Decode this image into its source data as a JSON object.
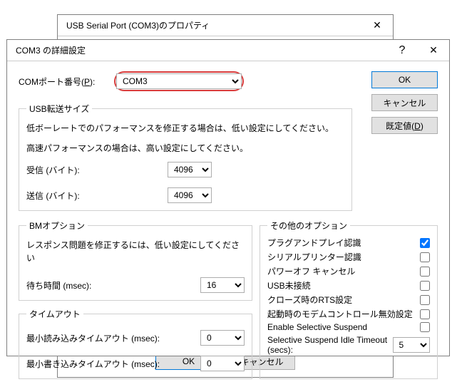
{
  "parent_window": {
    "title": "USB Serial Port (COM3)のプロパティ",
    "buttons": {
      "ok": "OK",
      "cancel": "キャンセル"
    }
  },
  "dialog": {
    "title": "COM3 の詳細設定",
    "com_port_label": "COMポート番号(P):",
    "com_port_value": "COM3",
    "buttons": {
      "ok": "OK",
      "cancel": "キャンセル",
      "defaults": "既定値(D)"
    }
  },
  "usb": {
    "legend": "USB転送サイズ",
    "line1": "低ボーレートでのパフォーマンスを修正する場合は、低い設定にしてください。",
    "line2": "高速パフォーマンスの場合は、高い設定にしてください。",
    "recv_label": "受信 (バイト):",
    "recv_value": "4096",
    "send_label": "送信 (バイト):",
    "send_value": "4096"
  },
  "bm": {
    "legend": "BMオプション",
    "line1": "レスポンス問題を修正するには、低い設定にしてください",
    "wait_label": "待ち時間 (msec):",
    "wait_value": "16"
  },
  "timeout": {
    "legend": "タイムアウト",
    "read_label": "最小読み込みタイムアウト (msec):",
    "read_value": "0",
    "write_label": "最小書き込みタイムアウト (msec):",
    "write_value": "0"
  },
  "other": {
    "legend": "その他のオプション",
    "items": [
      {
        "label": "プラグアンドプレイ認識",
        "checked": true
      },
      {
        "label": "シリアルプリンター認識",
        "checked": false
      },
      {
        "label": "パワーオフ キャンセル",
        "checked": false
      },
      {
        "label": "USB未接続",
        "checked": false
      },
      {
        "label": "クローズ時のRTS設定",
        "checked": false
      },
      {
        "label": "起動時のモデムコントロール無効設定",
        "checked": false
      },
      {
        "label": "Enable Selective Suspend",
        "checked": false
      }
    ],
    "suspend_label": "Selective Suspend Idle Timeout (secs):",
    "suspend_value": "5"
  }
}
